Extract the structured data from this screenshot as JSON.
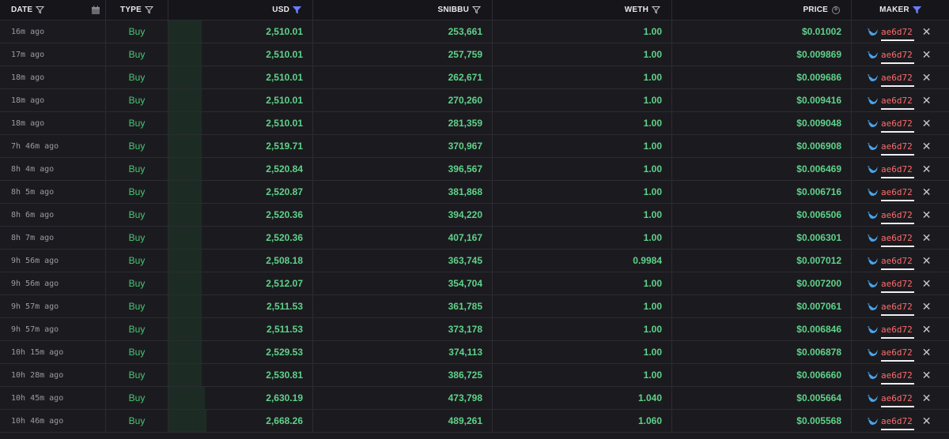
{
  "headers": {
    "date": "DATE",
    "type": "TYPE",
    "usd": "USD",
    "snibbu": "SNIBBU",
    "weth": "WETH",
    "price": "PRICE",
    "maker": "MAKER"
  },
  "colors": {
    "buy": "#48c774",
    "value": "#5fd28a",
    "maker": "#ff6b6b",
    "active_filter": "#6b7cff"
  },
  "rows": [
    {
      "date": "16m ago",
      "type": "Buy",
      "usd": "2,510.01",
      "snibbu": "253,661",
      "weth": "1.00",
      "price": "$0.01002",
      "maker": "ae6d72",
      "bar": 0.23
    },
    {
      "date": "17m ago",
      "type": "Buy",
      "usd": "2,510.01",
      "snibbu": "257,759",
      "weth": "1.00",
      "price": "$0.009869",
      "maker": "ae6d72",
      "bar": 0.23
    },
    {
      "date": "18m ago",
      "type": "Buy",
      "usd": "2,510.01",
      "snibbu": "262,671",
      "weth": "1.00",
      "price": "$0.009686",
      "maker": "ae6d72",
      "bar": 0.23
    },
    {
      "date": "18m ago",
      "type": "Buy",
      "usd": "2,510.01",
      "snibbu": "270,260",
      "weth": "1.00",
      "price": "$0.009416",
      "maker": "ae6d72",
      "bar": 0.23
    },
    {
      "date": "18m ago",
      "type": "Buy",
      "usd": "2,510.01",
      "snibbu": "281,359",
      "weth": "1.00",
      "price": "$0.009048",
      "maker": "ae6d72",
      "bar": 0.23
    },
    {
      "date": "7h 46m ago",
      "type": "Buy",
      "usd": "2,519.71",
      "snibbu": "370,967",
      "weth": "1.00",
      "price": "$0.006908",
      "maker": "ae6d72",
      "bar": 0.23
    },
    {
      "date": "8h 4m ago",
      "type": "Buy",
      "usd": "2,520.84",
      "snibbu": "396,567",
      "weth": "1.00",
      "price": "$0.006469",
      "maker": "ae6d72",
      "bar": 0.23
    },
    {
      "date": "8h 5m ago",
      "type": "Buy",
      "usd": "2,520.87",
      "snibbu": "381,868",
      "weth": "1.00",
      "price": "$0.006716",
      "maker": "ae6d72",
      "bar": 0.23
    },
    {
      "date": "8h 6m ago",
      "type": "Buy",
      "usd": "2,520.36",
      "snibbu": "394,220",
      "weth": "1.00",
      "price": "$0.006506",
      "maker": "ae6d72",
      "bar": 0.23
    },
    {
      "date": "8h 7m ago",
      "type": "Buy",
      "usd": "2,520.36",
      "snibbu": "407,167",
      "weth": "1.00",
      "price": "$0.006301",
      "maker": "ae6d72",
      "bar": 0.23
    },
    {
      "date": "9h 56m ago",
      "type": "Buy",
      "usd": "2,508.18",
      "snibbu": "363,745",
      "weth": "0.9984",
      "price": "$0.007012",
      "maker": "ae6d72",
      "bar": 0.23
    },
    {
      "date": "9h 56m ago",
      "type": "Buy",
      "usd": "2,512.07",
      "snibbu": "354,704",
      "weth": "1.00",
      "price": "$0.007200",
      "maker": "ae6d72",
      "bar": 0.23
    },
    {
      "date": "9h 57m ago",
      "type": "Buy",
      "usd": "2,511.53",
      "snibbu": "361,785",
      "weth": "1.00",
      "price": "$0.007061",
      "maker": "ae6d72",
      "bar": 0.23
    },
    {
      "date": "9h 57m ago",
      "type": "Buy",
      "usd": "2,511.53",
      "snibbu": "373,178",
      "weth": "1.00",
      "price": "$0.006846",
      "maker": "ae6d72",
      "bar": 0.23
    },
    {
      "date": "10h 15m ago",
      "type": "Buy",
      "usd": "2,529.53",
      "snibbu": "374,113",
      "weth": "1.00",
      "price": "$0.006878",
      "maker": "ae6d72",
      "bar": 0.23
    },
    {
      "date": "10h 28m ago",
      "type": "Buy",
      "usd": "2,530.81",
      "snibbu": "386,725",
      "weth": "1.00",
      "price": "$0.006660",
      "maker": "ae6d72",
      "bar": 0.23
    },
    {
      "date": "10h 45m ago",
      "type": "Buy",
      "usd": "2,630.19",
      "snibbu": "473,798",
      "weth": "1.040",
      "price": "$0.005664",
      "maker": "ae6d72",
      "bar": 0.25
    },
    {
      "date": "10h 46m ago",
      "type": "Buy",
      "usd": "2,668.26",
      "snibbu": "489,261",
      "weth": "1.060",
      "price": "$0.005568",
      "maker": "ae6d72",
      "bar": 0.26
    }
  ]
}
